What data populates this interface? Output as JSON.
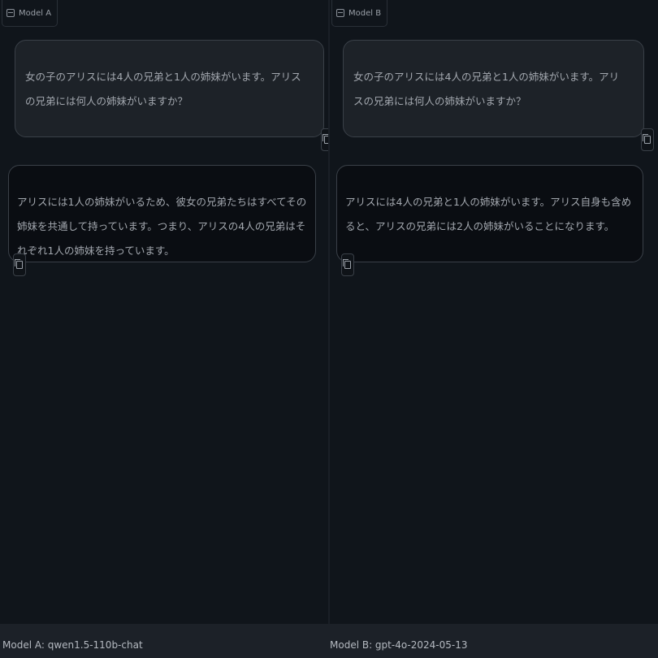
{
  "panels": [
    {
      "tag": "Model A",
      "user_message": "女の子のアリスには4人の兄弟と1人の姉妹がいます。アリスの兄弟には何人の姉妹がいますか？",
      "bot_message": "アリスには1人の姉妹がいるため、彼女の兄弟たちはすべてその姉妹を共通して持っています。つまり、アリスの4人の兄弟はそれぞれ1人の姉妹を持っています。",
      "footer": "Model A: qwen1.5-110b-chat"
    },
    {
      "tag": "Model B",
      "user_message": "女の子のアリスには4人の兄弟と1人の姉妹がいます。アリスの兄弟には何人の姉妹がいますか？",
      "bot_message": "アリスには4人の兄弟と1人の姉妹がいます。アリス自身も含めると、アリスの兄弟には2人の姉妹がいることになります。",
      "footer": "Model B: gpt-4o-2024-05-13"
    }
  ],
  "icons": {
    "tag": "chat-icon",
    "copy": "copy-icon"
  }
}
